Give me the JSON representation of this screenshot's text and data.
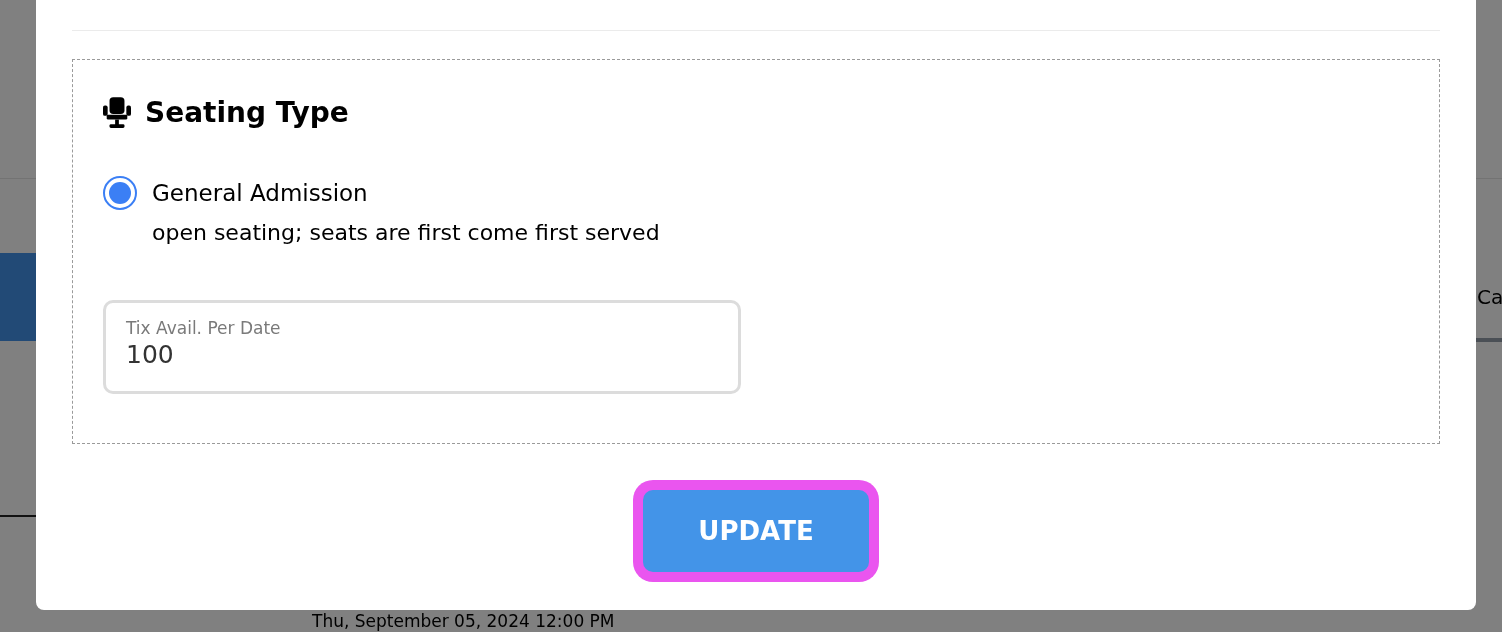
{
  "background": {
    "tab_label": "Ca",
    "date": "Thu, September 05, 2024 12:00 PM"
  },
  "modal": {
    "section": {
      "title": "Seating Type",
      "options": [
        {
          "label": "General Admission",
          "description": "open seating; seats are first come first served",
          "selected": true
        }
      ],
      "field": {
        "label": "Tix Avail. Per Date",
        "value": "100"
      }
    },
    "button": {
      "label": "UPDATE",
      "focused": true
    }
  }
}
